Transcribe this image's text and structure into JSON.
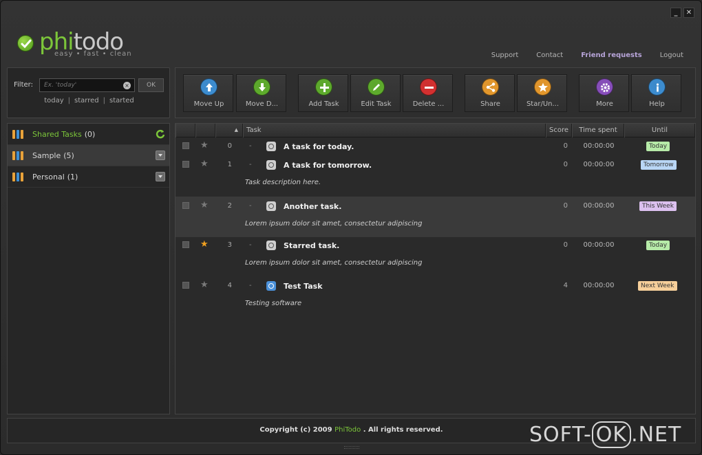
{
  "window": {
    "minimize": "_",
    "close": "✕"
  },
  "logo": {
    "phi": "phi",
    "todo": "todo",
    "tagline": "easy • fast • clean"
  },
  "toplinks": [
    "Support",
    "Contact",
    "Friend requests",
    "Logout"
  ],
  "filter": {
    "label": "Filter:",
    "placeholder": "Ex. 'today'",
    "ok": "OK",
    "quick": [
      "today",
      "starred",
      "started"
    ]
  },
  "lists": [
    {
      "name": "Shared Tasks",
      "count": "(0)",
      "icon": "refresh-icon"
    },
    {
      "name": "Sample",
      "count": "(5)",
      "icon": "menu-icon"
    },
    {
      "name": "Personal",
      "count": "(1)",
      "icon": "menu-icon"
    }
  ],
  "toolbar": [
    {
      "label": "Move Up",
      "color": "#3d8fd4",
      "icon": "arrow-up-icon"
    },
    {
      "label": "Move D...",
      "color": "#5fae2c",
      "icon": "arrow-down-icon"
    },
    {
      "label": "Add Task",
      "color": "#5fae2c",
      "icon": "plus-icon"
    },
    {
      "label": "Edit Task",
      "color": "#5fae2c",
      "icon": "pencil-icon"
    },
    {
      "label": "Delete ...",
      "color": "#d83030",
      "icon": "minus-icon"
    },
    {
      "label": "Share",
      "color": "#e89a2c",
      "icon": "share-icon"
    },
    {
      "label": "Star/Un...",
      "color": "#e89a2c",
      "icon": "star-icon"
    },
    {
      "label": "More",
      "color": "#8a4fbf",
      "icon": "gear-icon"
    },
    {
      "label": "Help",
      "color": "#3d8fd4",
      "icon": "info-icon"
    }
  ],
  "columns": {
    "index": "▲",
    "task": "Task",
    "score": "Score",
    "time": "Time spent",
    "until": "Until"
  },
  "tasks": [
    {
      "index": "0",
      "title": "A task for today.",
      "desc": "",
      "score": "0",
      "time": "00:00:00",
      "until": "Today",
      "starred": false,
      "highlight": false
    },
    {
      "index": "1",
      "title": "A task for tomorrow.",
      "desc": "Task description here.",
      "score": "0",
      "time": "00:00:00",
      "until": "Tomorrow",
      "starred": false,
      "highlight": false
    },
    {
      "index": "2",
      "title": "Another task.",
      "desc": "Lorem ipsum dolor sit amet, consectetur adipiscing",
      "score": "0",
      "time": "00:00:00",
      "until": "This Week",
      "starred": false,
      "highlight": true
    },
    {
      "index": "3",
      "title": "Starred task.",
      "desc": "Lorem ipsum dolor sit amet, consectetur adipiscing",
      "score": "0",
      "time": "00:00:00",
      "until": "Today",
      "starred": true,
      "highlight": false
    },
    {
      "index": "4",
      "title": "Test Task",
      "desc": "Testing software",
      "score": "4",
      "time": "00:00:00",
      "until": "Next Week",
      "starred": false,
      "highlight": false
    }
  ],
  "badge_colors": {
    "Today": "#b6eaa8",
    "Tomorrow": "#b9d6f5",
    "This Week": "#dcc0ef",
    "Next Week": "#f6cf9a"
  },
  "footer": {
    "prefix": "Copyright (c) 2009",
    "brand": "PhiTodo",
    "suffix": ". All rights reserved."
  },
  "watermark": {
    "left": "SOFT-",
    "ok": "OK",
    "right": ".NET"
  }
}
